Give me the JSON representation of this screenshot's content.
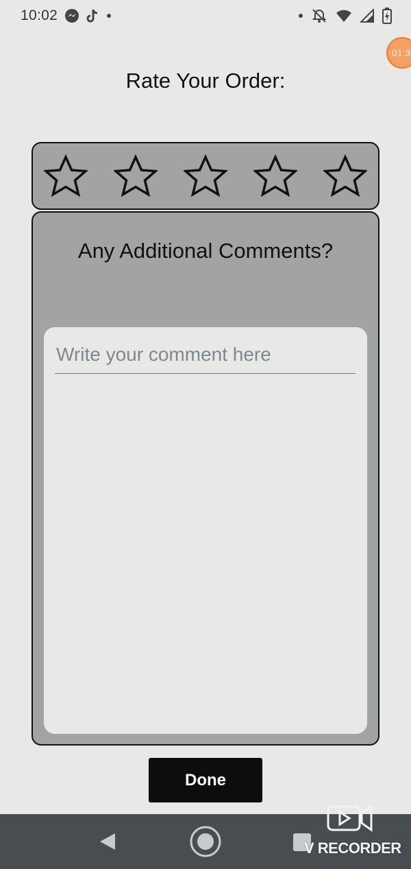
{
  "status_bar": {
    "time": "10:02",
    "left_icons": [
      "messenger-icon",
      "tiktok-icon",
      "notification-dot"
    ],
    "right_icons": [
      "notification-dot",
      "do-not-disturb-icon",
      "wifi-icon",
      "signal-icon",
      "battery-icon"
    ]
  },
  "timer_badge": "01:3",
  "title": "Rate Your Order:",
  "rating": {
    "max_stars": 5,
    "selected": 0
  },
  "comments": {
    "heading": "Any Additional Comments?",
    "input_placeholder": "Write your comment here",
    "input_value": ""
  },
  "done_label": "Done",
  "watermark": {
    "text": "V RECORDER"
  },
  "colors": {
    "background": "#e8e9e7",
    "card": "#a2a4a1",
    "button": "#0d0d0c",
    "nav_bar": "#474d51"
  }
}
